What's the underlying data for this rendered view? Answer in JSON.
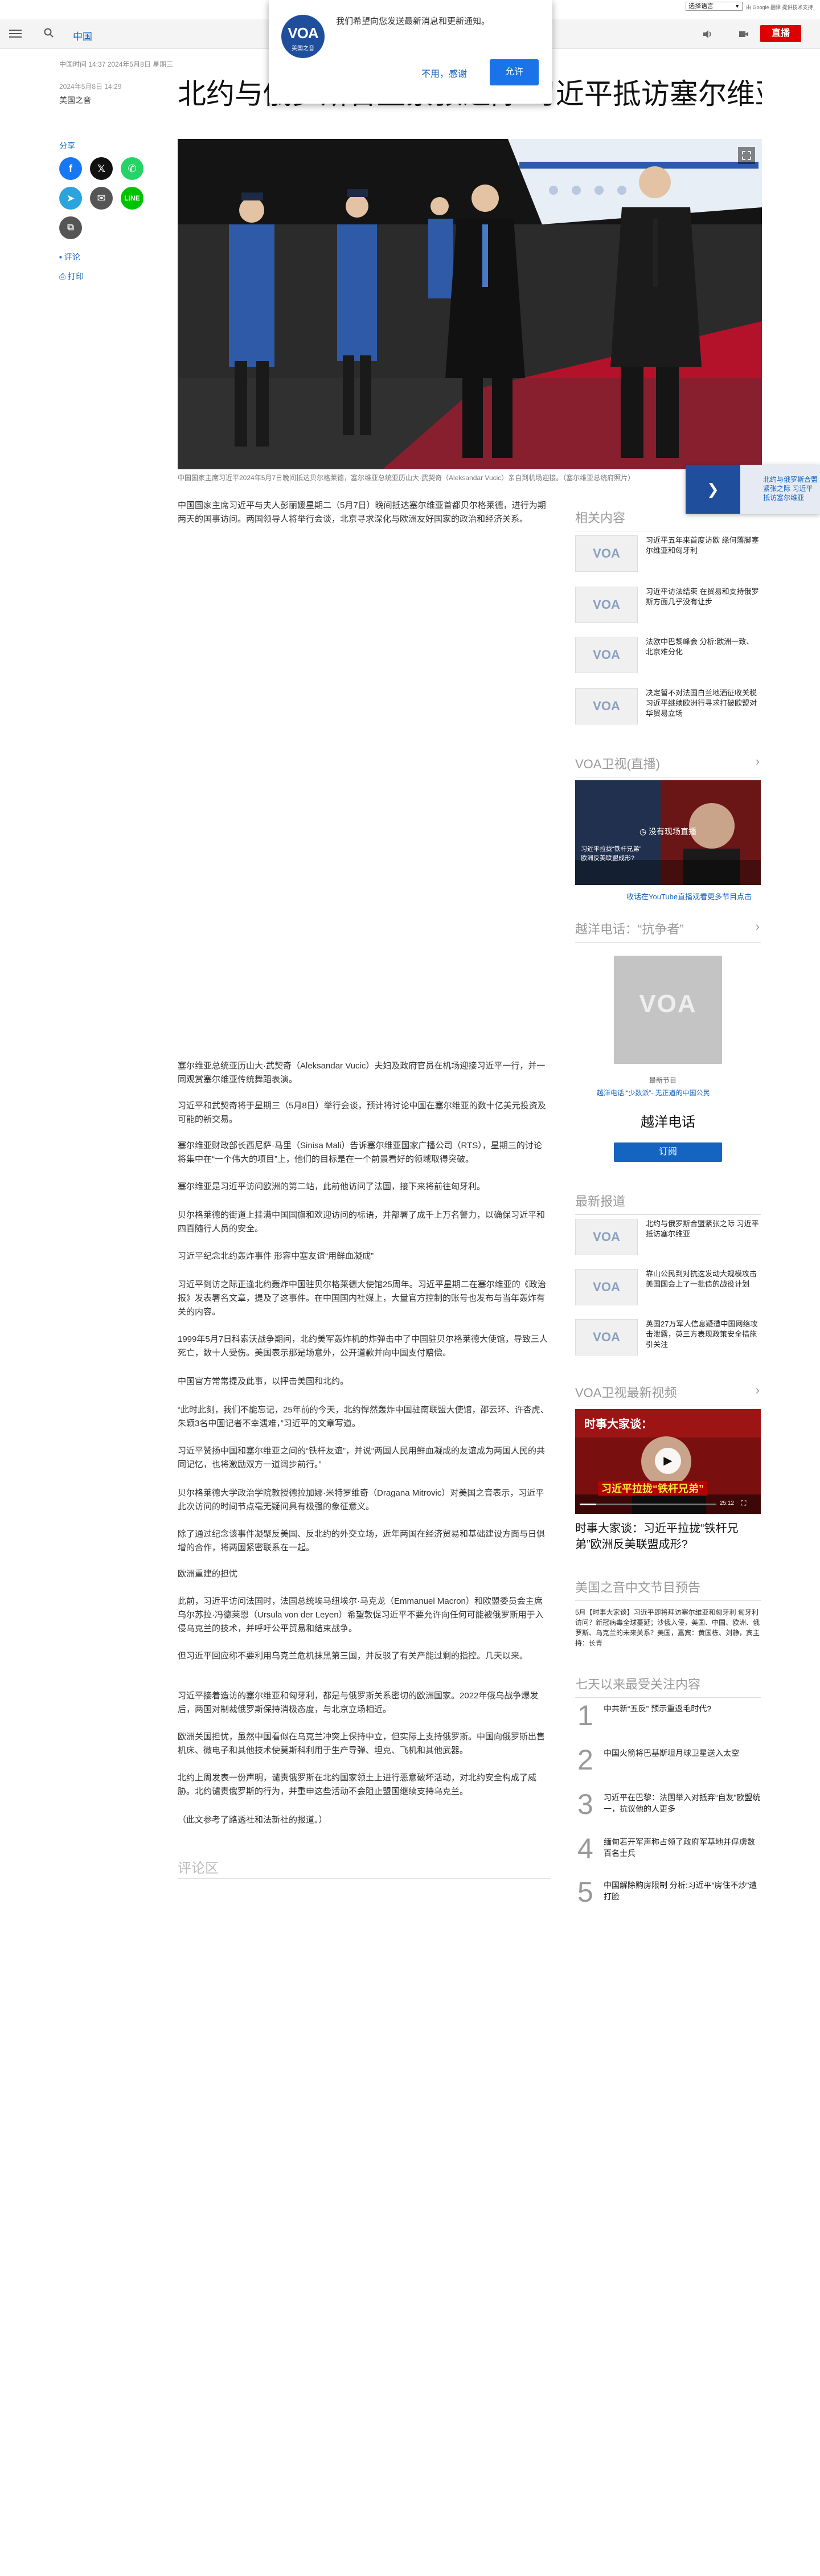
{
  "topbar": {
    "language_select": "选择语言",
    "translate_note": "由 Google 翻译 提供技术支持"
  },
  "nav": {
    "section": "中国",
    "live_label": "直播"
  },
  "notification": {
    "logo_text": "VOA",
    "logo_subtext": "美国之音",
    "message": "我们希望向您发送最新消息和更新通知。",
    "decline_label": "不用，感谢",
    "allow_label": "允许"
  },
  "article": {
    "meta_line": "中国时间 14:37 2024年5月8日 星期三",
    "date": "2024年5月8日 14:29",
    "source": "美国之音",
    "title": "北约与俄罗斯合盟紧张之际 习近平抵访塞尔维亚",
    "photo_caption": "中国国家主席习近平2024年5月7日晚间抵达贝尔格莱德，塞尔维亚总统亚历山大·武契奇（Aleksandar Vucic）亲自到机场迎接。（塞尔维亚总统府照片）",
    "paragraphs": [
      "中国国家主席习近平与夫人彭丽媛星期二（5月7日）晚间抵达塞尔维亚首都贝尔格莱德，进行为期两天的国事访问。两国领导人将举行会谈，北京寻求深化与欧洲友好国家的政治和经济关系。",
      "塞尔维亚总统亚历山大·武契奇（Aleksandar Vucic）夫妇及政府官员在机场迎接习近平一行，并一同观赏塞尔维亚传统舞蹈表演。",
      "习近平和武契奇将于星期三（5月8日）举行会谈，预计将讨论中国在塞尔维亚的数十亿美元投资及可能的新交易。",
      "塞尔维亚财政部长西尼萨·马里（Sinisa Mali）告诉塞尔维亚国家广播公司（RTS），星期三的讨论将集中在“一个伟大的项目”上，他们的目标是在一个前景看好的领域取得突破。",
      "塞尔维亚是习近平访问欧洲的第二站，此前他访问了法国，接下来将前往匈牙利。",
      "贝尔格莱德的街道上挂满中国国旗和欢迎访问的标语，并部署了成千上万名警力，以确保习近平和四百随行人员的安全。",
      "习近平纪念北约轰炸事件 形容中塞友谊“用鲜血凝成”",
      "习近平到访之际正逢北约轰炸中国驻贝尔格莱德大使馆25周年。习近平星期二在塞尔维亚的《政治报》发表署名文章，提及了这事件。在中国国内社媒上，大量官方控制的账号也发布与当年轰炸有关的内容。",
      "1999年5月7日科索沃战争期间，北约美军轰炸机的炸弹击中了中国驻贝尔格莱德大使馆，导致三人死亡，数十人受伤。美国表示那是场意外，公开道歉并向中国支付赔偿。",
      "中国官方常常提及此事，以抨击美国和北约。",
      "“此时此刻，我们不能忘记，25年前的今天，北约悍然轰炸中国驻南联盟大使馆，邵云环、许杏虎、朱颖3名中国记者不幸遇难，”习近平的文章写道。",
      "习近平赞扬中国和塞尔维亚之间的“铁杆友谊”，并说“两国人民用鲜血凝成的友谊成为两国人民的共同记忆，也将激励双方一道阔步前行。”",
      "贝尔格莱德大学政治学院教授德拉加娜·米特罗维奇（Dragana Mitrovic）对美国之音表示，习近平此次访问的时间节点毫无疑问具有极强的象征意义。",
      "除了通过纪念该事件凝聚反美国、反北约的外交立场，近年两国在经济贸易和基础建设方面与日俱增的合作，将两国紧密联系在一起。",
      "欧洲重建的担忧",
      "此前，习近平访问法国时，法国总统埃马纽埃尔·马克龙（Emmanuel Macron）和欧盟委员会主席乌尔苏拉·冯德莱恩（Ursula von der Leyen）希望敦促习近平不要允许向任何可能被俄罗斯用于入侵乌克兰的技术，并呼吁公平贸易和结束战争。",
      "但习近平回应称不要利用乌克兰危机抹黑第三国，并反驳了有关产能过剩的指控。几天以来。",
      "习近平接着造访的塞尔维亚和匈牙利，都是与俄罗斯关系密切的欧洲国家。2022年俄乌战争爆发后，两国对制裁俄罗斯保持消极态度，与北京立场相近。",
      "欧洲关国担忧，虽然中国看似在乌克兰冲突上保持中立，但实际上支持俄罗斯。中国向俄罗斯出售机床、微电子和其他技术使莫斯科利用于生产导弹、坦克、飞机和其他武器。",
      "北约上周发表一份声明，谴责俄罗斯在北约国家领土上进行恶意破坏活动，对北约安全构成了威胁。北约谴责俄罗斯的行为，并重申这些活动不会阻止盟国继续支持乌克兰。",
      "（此文参考了路透社和法新社的报道。）"
    ]
  },
  "share": {
    "label": "分享",
    "facebook_icon": "f",
    "x_icon": "𝕏",
    "whatsapp_icon": "✆",
    "telegram_icon": "➤",
    "email_icon": "✉",
    "line_icon": "LINE",
    "copy_icon": "⧉",
    "comments_label": "评论",
    "print_label": "打印"
  },
  "sidebar": {
    "related_heading": "相关内容",
    "related": [
      {
        "thumb": "VOA",
        "title": "习近平五年来首度访欧 缘何落脚塞尔维亚和匈牙利"
      },
      {
        "thumb": "VOA",
        "title": "习近平访法结束 在贸易和支持俄罗斯方面几乎没有让步"
      },
      {
        "thumb": "VOA",
        "title": "法欧中巴黎峰会 分析:欧洲一致、北京难分化"
      },
      {
        "thumb": "VOA",
        "title": "决定暂不对法国白兰地酒征收关税 习近平继续欧洲行寻求打破欧盟对华贸易立场"
      }
    ],
    "live_heading": "VOA卫视(直播)",
    "live_thumb_caption_1": "习近平拉拢“铁杆兄弟”",
    "live_thumb_caption_2": "欧洲反美联盟成形?",
    "live_no_signal": "没有现场直播",
    "live_watch_link": "收话在YouTube直播观看更多节目点击",
    "podcast_heading": "越洋电话：“抗争者”",
    "podcast_cover_text": "VOA",
    "podcast_subtitle": "最新节目",
    "podcast_desc": "越洋电话:“少数派”- 无正道的中国公民",
    "podcast_name": "越洋电话",
    "subscribe_label": "订阅",
    "latest_heading": "最新报道",
    "latest": [
      {
        "thumb": "VOA",
        "title": "北约与俄罗斯合盟紧张之际 习近平抵访塞尔维亚"
      },
      {
        "thumb": "VOA",
        "title": "靠山公民到对抗这发动大规模攻击 美国国会上了一批债的战役计划"
      },
      {
        "thumb": "VOA",
        "title": "英国27万军人信息疑遭中国网络攻击泄露，英三方表现政策安全措施引关注"
      }
    ],
    "video_heading": "VOA卫视最新视频",
    "video_caption_top": "时事大家谈：",
    "video_caption_main": "习近平拉拢“铁杆兄弟”",
    "video_time": "25:12",
    "video_title": "时事大家谈：习近平拉拢“铁杆兄弟”欧洲反美联盟成形?",
    "digest_heading": "美国之音中文节目预告",
    "digest_text": "5月【时事大家谈】习近平即将拜访塞尔维亚和匈牙利 匈牙利访问？新冠病毒全球蔓延；沙俄入侵，美国、中国、欧洲、俄罗斯、乌克兰的未来关系？美国，嘉宾：黄国栋、刘静，宾主持：长青",
    "most_popular_heading": "七天以来最受关注内容",
    "most_popular": [
      {
        "num": "1",
        "title": "中共新“五反” 预示重返毛时代?"
      },
      {
        "num": "2",
        "title": "中国火箭将巴基斯坦月球卫星送入太空"
      },
      {
        "num": "3",
        "title": "习近平在巴黎：法国举入对抵弃“自友”欧盟统一，抗议他的人更多"
      },
      {
        "num": "4",
        "title": "缅甸若开军声称占领了政府军基地并俘虏数百名士兵"
      },
      {
        "num": "5",
        "title": "中国解除购房限制 分析:习近平“房住不炒”遭打脸"
      }
    ]
  },
  "comments": {
    "heading": "评论区"
  },
  "colors": {
    "accent": "#1565c0",
    "live_red": "#dd0000",
    "voa_blue": "#1f4e9c"
  }
}
